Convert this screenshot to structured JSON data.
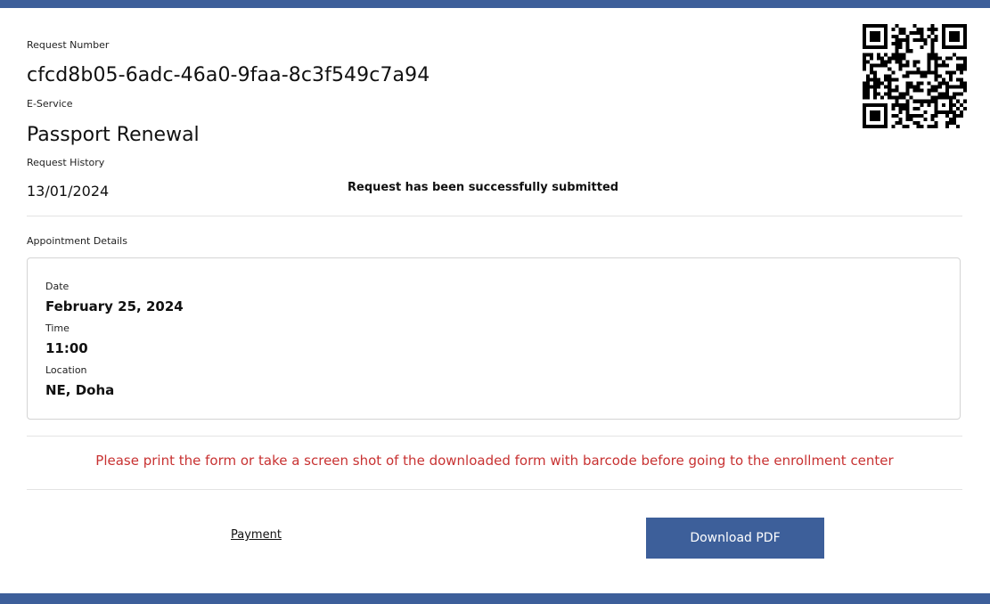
{
  "colors": {
    "accent": "#3d5f9a",
    "notice": "#c83232",
    "qr": "#000000"
  },
  "request": {
    "number_label": "Request Number",
    "number": "cfcd8b05-6adc-46a0-9faa-8c3f549c7a94",
    "service_label": "E-Service",
    "service": "Passport Renewal",
    "history_label": "Request History",
    "history": [
      {
        "date": "13/01/2024",
        "status": "Request has been successfully submitted"
      }
    ]
  },
  "appointment": {
    "section_label": "Appointment Details",
    "date_label": "Date",
    "date": "February 25, 2024",
    "time_label": "Time",
    "time": "11:00",
    "location_label": "Location",
    "location": "NE, Doha"
  },
  "notice": "Please print the form or take a screen shot of the downloaded form with barcode before going to the enrollment center",
  "actions": {
    "payment_label": "Payment",
    "download_label": "Download PDF"
  },
  "qr_icon": "qr-code-icon"
}
